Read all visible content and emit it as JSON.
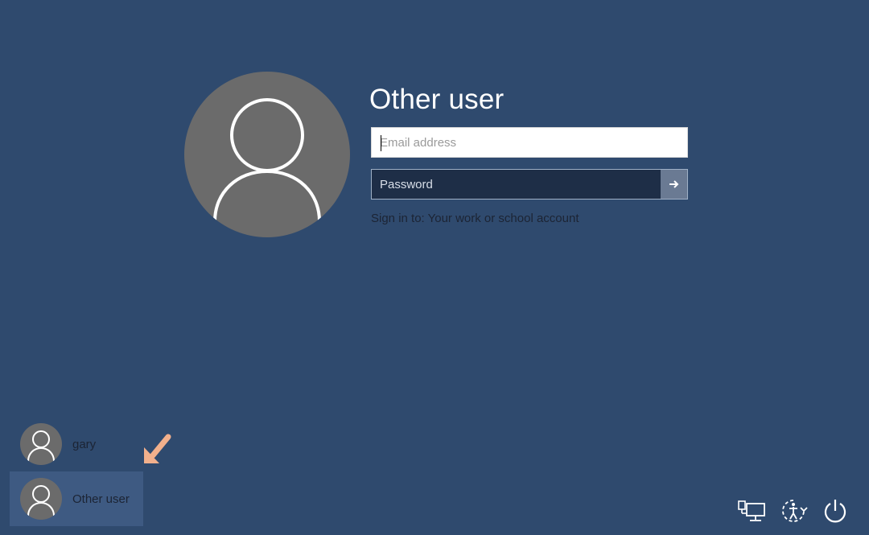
{
  "login": {
    "title": "Other user",
    "email_placeholder": "Email address",
    "password_placeholder": "Password",
    "sign_in_to": "Sign in to: Your work or school account"
  },
  "users": [
    {
      "name": "gary",
      "selected": false
    },
    {
      "name": "Other user",
      "selected": true
    }
  ],
  "system_icons": [
    "network-icon",
    "ease-of-access-icon",
    "power-icon"
  ],
  "colors": {
    "background": "#2f4a6e",
    "selected_user_bg": "#3e5a82",
    "avatar_gray": "#6b6b6b",
    "hint_arrow": "#f2b08c"
  }
}
